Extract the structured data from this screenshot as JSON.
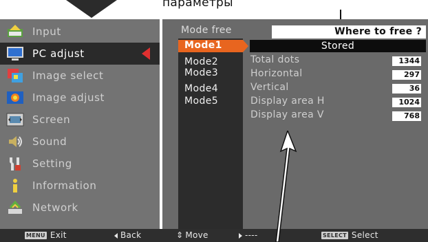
{
  "caption": "параметры",
  "left_menu": {
    "items": [
      {
        "label": "Input",
        "icon": "input-icon"
      },
      {
        "label": "PC adjust",
        "icon": "pc-adjust-icon"
      },
      {
        "label": "Image select",
        "icon": "image-select-icon"
      },
      {
        "label": "Image adjust",
        "icon": "image-adjust-icon"
      },
      {
        "label": "Screen",
        "icon": "screen-icon"
      },
      {
        "label": "Sound",
        "icon": "sound-icon"
      },
      {
        "label": "Setting",
        "icon": "setting-icon"
      },
      {
        "label": "Information",
        "icon": "information-icon"
      },
      {
        "label": "Network",
        "icon": "network-icon"
      }
    ],
    "active_index": 1
  },
  "mode_panel": {
    "title": "Mode free",
    "modes": [
      "Mode1",
      "Mode2",
      "Mode3",
      "Mode4",
      "Mode5"
    ],
    "selected": "Mode1"
  },
  "where_to_free": "Where to free ?",
  "stored_label": "Stored",
  "params": [
    {
      "label": "Total dots",
      "value": "1344"
    },
    {
      "label": "Horizontal",
      "value": "297"
    },
    {
      "label": "Vertical",
      "value": "36"
    },
    {
      "label": "Display area H",
      "value": "1024"
    },
    {
      "label": "Display area V",
      "value": "768"
    }
  ],
  "bottom_bar": {
    "exit_key": "MENU",
    "exit_label": "Exit",
    "back_label": "Back",
    "move_label": "Move",
    "next_label": "----",
    "select_key": "SELECT",
    "select_label": "Select"
  },
  "colors": {
    "accent_orange": "#e8651f",
    "active_arrow_red": "#e03030",
    "menu_bg": "#737373",
    "panel_bg": "#6a6a6a"
  }
}
